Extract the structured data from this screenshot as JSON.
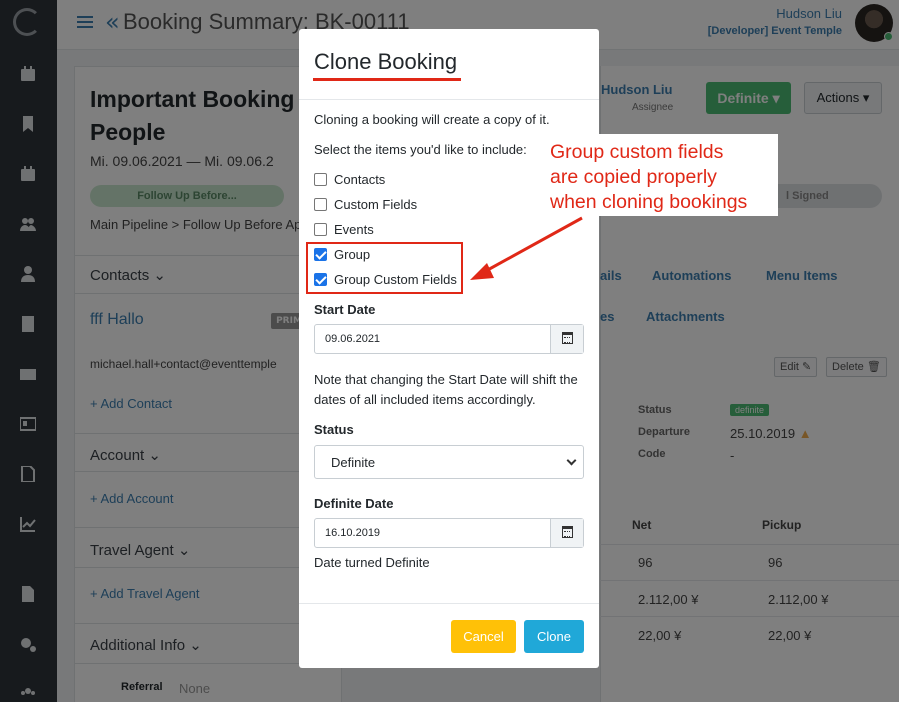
{
  "header": {
    "title": "Booking Summary: BK-00111",
    "user_name": "Hudson Liu",
    "user_role": "[Developer] Event Temple"
  },
  "sidebar": {
    "icons": [
      "logo-icon",
      "calendar-icon",
      "bookmark-icon",
      "calendar-check-icon",
      "users-icon",
      "user-icon",
      "building-icon",
      "envelope-icon",
      "id-card-icon",
      "file-icon",
      "chart-line-icon",
      "document-icon",
      "cogs-icon",
      "team-icon"
    ]
  },
  "booking": {
    "name": "Important Booking f\nPeople",
    "dates": "Mi. 09.06.2021  —  Mi. 09.06.2",
    "status_pill": "Follow Up Before...",
    "pipeline": "Main Pipeline > Follow Up Before Ap",
    "sections": {
      "contacts": "Contacts",
      "account": "Account",
      "travel_agent": "Travel Agent",
      "additional_info": "Additional Info"
    },
    "contact_name": "fff Hallo",
    "contact_badge": "PRIM",
    "contact_email": "michael.hall+contact@eventtemple",
    "add_contact": "Add Contact",
    "add_account": "Add Account",
    "add_travel_agent": "Add Travel Agent",
    "referral_label": "Referral",
    "referral_value": "None",
    "assignee_name": "Hudson Liu",
    "assignee_label": "Assignee",
    "status_button": "Definite",
    "actions_button": "Actions",
    "signed_pill": "l Signed",
    "tabs": [
      "ails",
      "Automations",
      "Menu Items",
      "es",
      "Attachments"
    ],
    "edit_button": "Edit",
    "delete_button": "Delete",
    "info": {
      "status_label": "Status",
      "status_value": "definite",
      "departure_label": "Departure",
      "departure_value": "25.10.2019",
      "code_label": "Code",
      "code_value": "-"
    },
    "table": {
      "headers": [
        "Net",
        "Pickup"
      ],
      "rows": [
        [
          "96",
          "96"
        ],
        [
          "2.112,00 ¥",
          "2.112,00 ¥"
        ],
        [
          "22,00 ¥",
          "22,00 ¥"
        ]
      ]
    }
  },
  "modal": {
    "title": "Clone Booking",
    "intro": "Cloning a booking will create a copy of it.",
    "select_prompt": "Select the items you'd like to include:",
    "items": [
      {
        "label": "Contacts",
        "checked": false
      },
      {
        "label": "Custom Fields",
        "checked": false
      },
      {
        "label": "Events",
        "checked": false
      },
      {
        "label": "Group",
        "checked": true
      },
      {
        "label": "Group Custom Fields",
        "checked": true
      }
    ],
    "start_date_label": "Start Date",
    "start_date_value": "09.06.2021",
    "start_date_note": "Note that changing the Start Date will shift the dates of all included items accordingly.",
    "status_label": "Status",
    "status_value": "Definite",
    "definite_date_label": "Definite Date",
    "definite_date_value": "16.10.2019",
    "definite_date_help": "Date turned Definite",
    "cancel_label": "Cancel",
    "clone_label": "Clone"
  },
  "annotation": {
    "text": "Group custom fields\nare copied properly\nwhen cloning bookings",
    "color": "#e02817"
  }
}
